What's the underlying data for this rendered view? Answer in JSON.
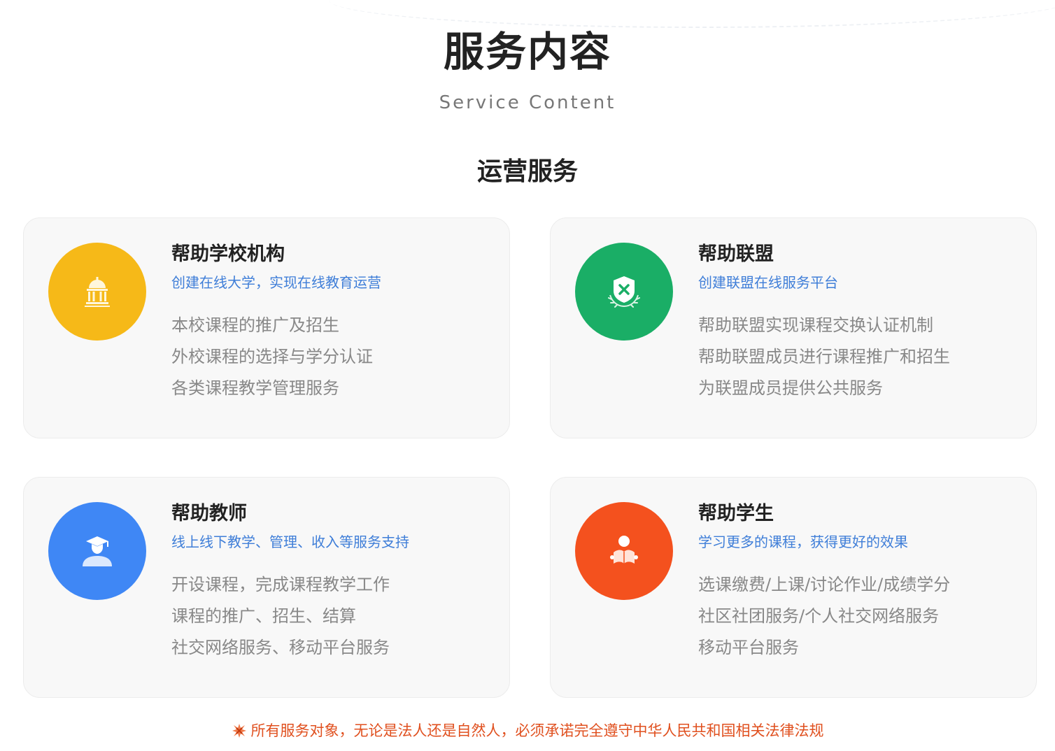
{
  "header": {
    "title": "服务内容",
    "subtitle": "Service Content"
  },
  "section": {
    "title": "运营服务"
  },
  "cards": [
    {
      "title": "帮助学校机构",
      "subtitle": "创建在线大学，实现在线教育运营",
      "lines": [
        "本校课程的推广及招生",
        "外校课程的选择与学分认证",
        "各类课程教学管理服务"
      ],
      "icon": "school-building-icon",
      "color": "#f6b918"
    },
    {
      "title": "帮助联盟",
      "subtitle": "创建联盟在线服务平台",
      "lines": [
        "帮助联盟实现课程交换认证机制",
        "帮助联盟成员进行课程推广和招生",
        "为联盟成员提供公共服务"
      ],
      "icon": "alliance-shield-icon",
      "color": "#1aae66"
    },
    {
      "title": "帮助教师",
      "subtitle": "线上线下教学、管理、收入等服务支持",
      "lines": [
        "开设课程，完成课程教学工作",
        "课程的推广、招生、结算",
        "社交网络服务、移动平台服务"
      ],
      "icon": "teacher-graduate-icon",
      "color": "#3f87f5"
    },
    {
      "title": "帮助学生",
      "subtitle": "学习更多的课程，获得更好的效果",
      "lines": [
        "选课缴费/上课/讨论作业/成绩学分",
        "社区社团服务/个人社交网络服务",
        "移动平台服务"
      ],
      "icon": "student-reading-icon",
      "color": "#f4511e"
    }
  ],
  "footnote": {
    "text": "所有服务对象，无论是法人还是自然人，必须承诺完全遵守中华人民共和国相关法律法规",
    "icon": "warning-burst-icon",
    "color": "#e0501f"
  }
}
